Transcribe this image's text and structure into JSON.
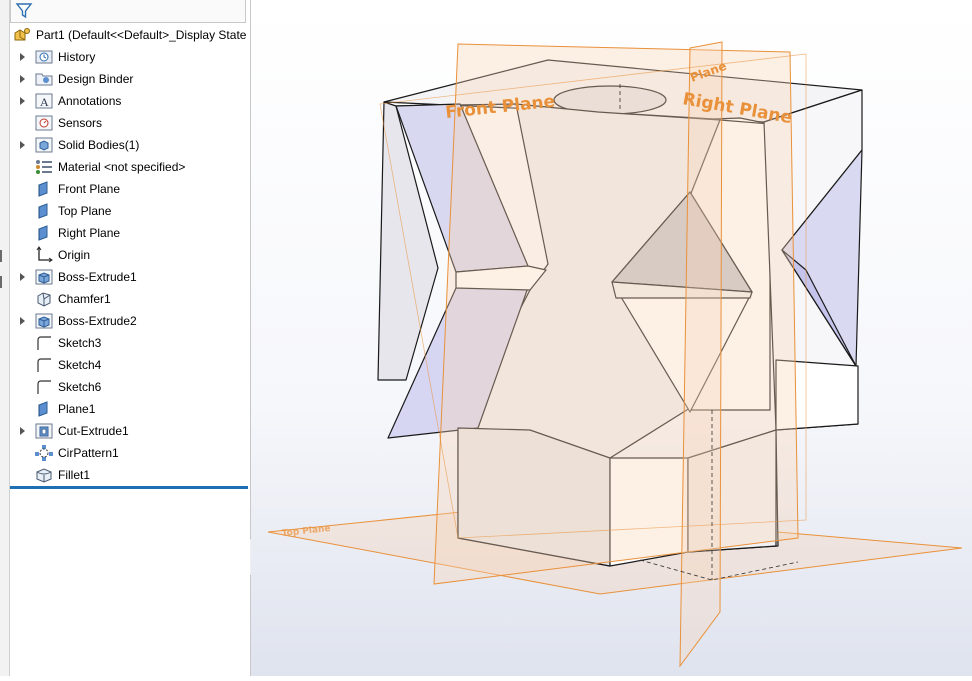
{
  "tree": {
    "root": {
      "label": "Part1  (Default<<Default>_Display State",
      "icon": "part-icon"
    },
    "items": [
      {
        "label": "History",
        "icon": "history-icon",
        "expandable": true
      },
      {
        "label": "Design Binder",
        "icon": "design-binder-icon",
        "expandable": true
      },
      {
        "label": "Annotations",
        "icon": "annotations-icon",
        "expandable": true
      },
      {
        "label": "Sensors",
        "icon": "sensors-icon",
        "expandable": false
      },
      {
        "label": "Solid Bodies(1)",
        "icon": "solid-bodies-icon",
        "expandable": true
      },
      {
        "label": "Material <not specified>",
        "icon": "material-icon",
        "expandable": false
      },
      {
        "label": "Front Plane",
        "icon": "plane-icon",
        "expandable": false
      },
      {
        "label": "Top Plane",
        "icon": "plane-icon",
        "expandable": false
      },
      {
        "label": "Right Plane",
        "icon": "plane-icon",
        "expandable": false
      },
      {
        "label": "Origin",
        "icon": "origin-icon",
        "expandable": false
      },
      {
        "label": "Boss-Extrude1",
        "icon": "extrude-icon",
        "expandable": true
      },
      {
        "label": "Chamfer1",
        "icon": "chamfer-icon",
        "expandable": false
      },
      {
        "label": "Boss-Extrude2",
        "icon": "extrude-icon",
        "expandable": true
      },
      {
        "label": "Sketch3",
        "icon": "sketch-icon",
        "expandable": false
      },
      {
        "label": "Sketch4",
        "icon": "sketch-icon",
        "expandable": false
      },
      {
        "label": "Sketch6",
        "icon": "sketch-icon",
        "expandable": false
      },
      {
        "label": "Plane1",
        "icon": "plane-icon",
        "expandable": false
      },
      {
        "label": "Cut-Extrude1",
        "icon": "cut-extrude-icon",
        "expandable": true
      },
      {
        "label": "CirPattern1",
        "icon": "circular-pattern-icon",
        "expandable": false
      },
      {
        "label": "Fillet1",
        "icon": "fillet-icon",
        "expandable": false
      }
    ]
  },
  "viewport": {
    "plane_labels": {
      "front": "Front Plane",
      "right": "Right Plane",
      "plane": "Plane",
      "top": "Top Plane"
    }
  },
  "colors": {
    "plane_orange": "#e9913a",
    "rollback_bar": "#1f6fb5",
    "model_fill": "#f2f2f5",
    "model_blue_face": "#d6d6f2"
  }
}
